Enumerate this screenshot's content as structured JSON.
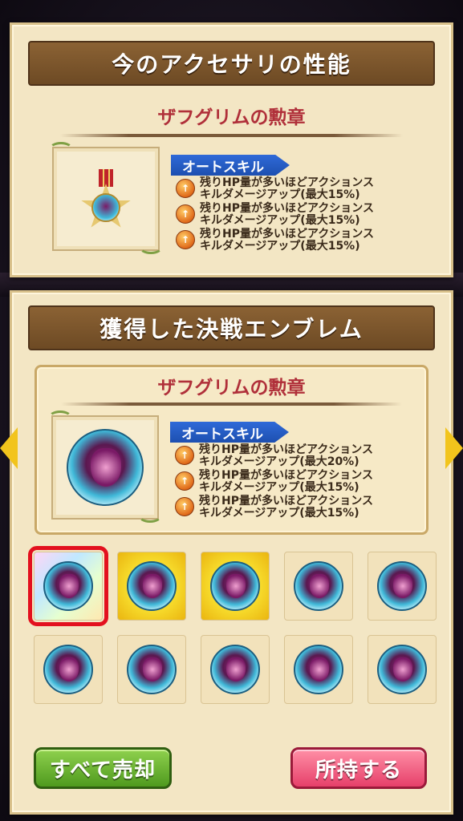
{
  "current": {
    "header": "今のアクセサリの性能",
    "item_name": "ザフグリムの勲章",
    "skill_tag": "オートスキル",
    "skills": [
      {
        "line1": "残りHP量が多いほどアクションス",
        "line2": "キルダメージアップ(最大15%)"
      },
      {
        "line1": "残りHP量が多いほどアクションス",
        "line2": "キルダメージアップ(最大15%)"
      },
      {
        "line1": "残りHP量が多いほどアクションス",
        "line2": "キルダメージアップ(最大15%)"
      }
    ]
  },
  "obtained": {
    "header": "獲得した決戦エンブレム",
    "item_name": "ザフグリムの勲章",
    "skill_tag": "オートスキル",
    "skills": [
      {
        "line1": "残りHP量が多いほどアクションス",
        "line2": "キルダメージアップ(最大20%)"
      },
      {
        "line1": "残りHP量が多いほどアクションス",
        "line2": "キルダメージアップ(最大15%)"
      },
      {
        "line1": "残りHP量が多いほどアクションス",
        "line2": "キルダメージアップ(最大15%)"
      }
    ]
  },
  "grid": {
    "slots": [
      {
        "rarity": "rainbow",
        "selected": true
      },
      {
        "rarity": "gold",
        "selected": false
      },
      {
        "rarity": "gold",
        "selected": false
      },
      {
        "rarity": "normal",
        "selected": false
      },
      {
        "rarity": "normal",
        "selected": false
      },
      {
        "rarity": "normal",
        "selected": false
      },
      {
        "rarity": "normal",
        "selected": false
      },
      {
        "rarity": "normal",
        "selected": false
      },
      {
        "rarity": "normal",
        "selected": false
      },
      {
        "rarity": "normal",
        "selected": false
      }
    ]
  },
  "buttons": {
    "sell_all": "すべて売却",
    "keep": "所持する"
  },
  "icons": {
    "skill": "attack-up-icon",
    "prev": "left-arrow-icon",
    "next": "right-arrow-icon"
  },
  "colors": {
    "title_bar": "#7a5429",
    "item_name": "#b0303a",
    "skill_tag": "#2a5fc8",
    "sell_button": "#5fae2a",
    "keep_button": "#f0557a",
    "selection": "#e3101e"
  }
}
